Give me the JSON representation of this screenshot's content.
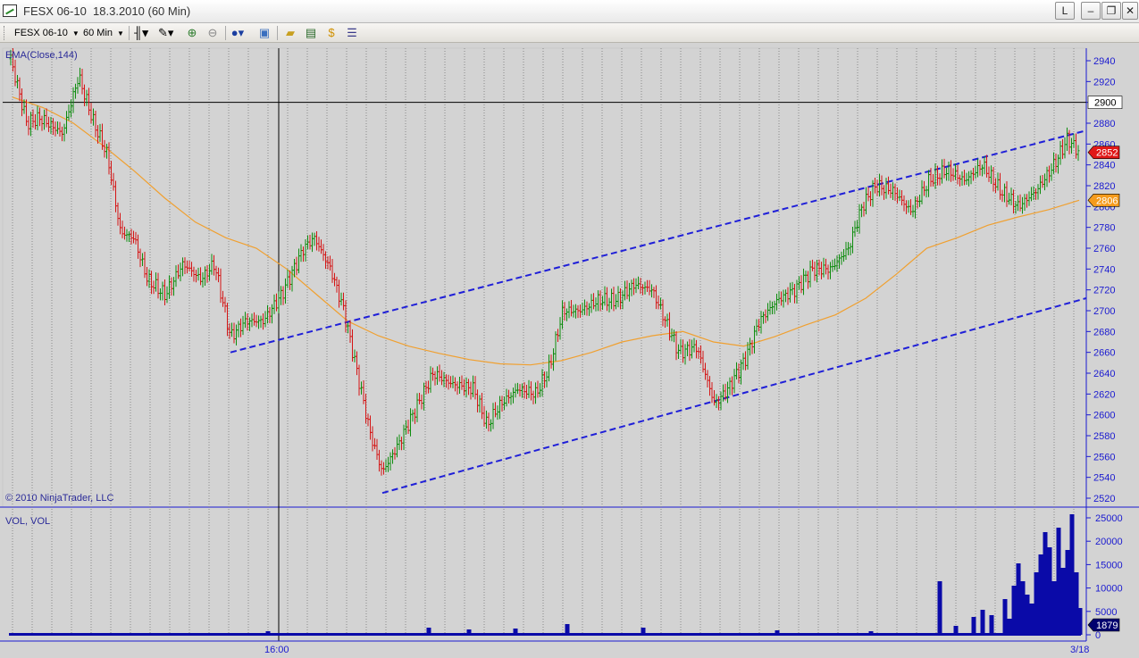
{
  "window": {
    "title": "FESX 06-10  18.3.2010 (60 Min)",
    "buttons": {
      "layout": "L",
      "minimize": "–",
      "restore": "❐",
      "close": "✕"
    }
  },
  "toolbar": {
    "instrument": "FESX 06-10",
    "interval": "60 Min",
    "icons": [
      "bar-type-icon",
      "drawing-tool-icon",
      "zoom-in-icon",
      "zoom-out-icon",
      "globe-icon",
      "properties-icon",
      "folder-icon",
      "chart-icon",
      "dollar-icon",
      "data-box-icon"
    ]
  },
  "chart": {
    "indicator_label": "EMA(Close,144)",
    "copyright": "© 2010 NinjaTrader, LLC",
    "volume_label": "VOL, VOL",
    "price_axis_ticks": [
      2940,
      2920,
      2900,
      2880,
      2860,
      2840,
      2820,
      2800,
      2780,
      2760,
      2740,
      2720,
      2700,
      2680,
      2660,
      2640,
      2620,
      2600,
      2580,
      2560,
      2540,
      2520
    ],
    "volume_axis_ticks": [
      "25000",
      "20000",
      "15000",
      "10000",
      "5000",
      "0"
    ],
    "time_labels": [
      "16:00",
      "3/18"
    ],
    "crosshair_price": "2900",
    "last_price_marker": "2852",
    "ema_marker": "2806",
    "last_volume_marker": "1879",
    "colors": {
      "up": "#0e8c0e",
      "down": "#d41515",
      "ema": "#f0a030",
      "channel": "#1f1fd8",
      "volume": "#0a0aa8",
      "axis": "#1a1ad0",
      "price_marker": "#e01818",
      "ema_marker": "#f59b1c",
      "volume_marker": "#00006e"
    }
  },
  "chart_data": {
    "type": "candlestick",
    "ylim": [
      2520,
      2950
    ],
    "series": [
      {
        "name": "EMA(Close,144)",
        "values": [
          2905,
          2895,
          2880,
          2858,
          2834,
          2808,
          2785,
          2770,
          2760,
          2740,
          2715,
          2690,
          2676,
          2666,
          2659,
          2653,
          2649,
          2648,
          2652,
          2660,
          2670,
          2676,
          2680,
          2670,
          2666,
          2675,
          2686,
          2696,
          2712,
          2735,
          2760,
          2770,
          2782,
          2790,
          2797,
          2806
        ]
      },
      {
        "name": "Channel upper",
        "values": [
          2660,
          2873
        ]
      },
      {
        "name": "Channel lower",
        "values": [
          2525,
          2712
        ]
      }
    ]
  }
}
